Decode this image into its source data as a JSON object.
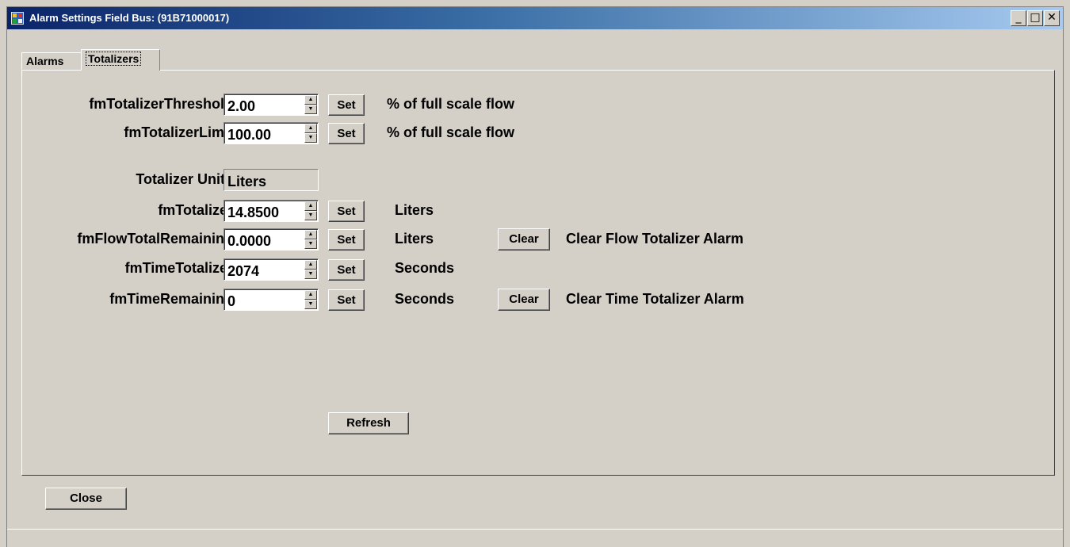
{
  "window": {
    "title": "Alarm Settings Field Bus: (91B71000017)",
    "buttons": {
      "minimize": "_",
      "maximize": "□",
      "close": "✕"
    }
  },
  "tabs": [
    {
      "label": "Alarms",
      "active": false
    },
    {
      "label": "Totalizers",
      "active": true
    }
  ],
  "fields": [
    {
      "label": "fmTotalizerThreshold",
      "value": "2.00",
      "set_label": "Set",
      "unit": "% of full scale flow"
    },
    {
      "label": "fmTotalizerLimit",
      "value": "100.00",
      "set_label": "Set",
      "unit": "% of full scale flow"
    },
    {
      "label": "fmTotalizer",
      "value": "14.8500",
      "set_label": "Set",
      "unit": "Liters"
    },
    {
      "label": "fmFlowTotalRemaining",
      "value": "0.0000",
      "set_label": "Set",
      "unit": "Liters",
      "clear_label": "Clear",
      "clear_desc": "Clear Flow Totalizer Alarm"
    },
    {
      "label": "fmTimeTotalizer",
      "value": "2074",
      "set_label": "Set",
      "unit": "Seconds"
    },
    {
      "label": "fmTimeRemaining",
      "value": "0",
      "set_label": "Set",
      "unit": "Seconds",
      "clear_label": "Clear",
      "clear_desc": "Clear Time Totalizer Alarm"
    }
  ],
  "totalizer_units": {
    "label": "Totalizer Units",
    "value": "Liters"
  },
  "refresh_label": "Refresh",
  "close_label": "Close",
  "colors": {
    "face": "#d4d0c8",
    "title_start": "#0a246a",
    "title_end": "#a6caf0"
  }
}
